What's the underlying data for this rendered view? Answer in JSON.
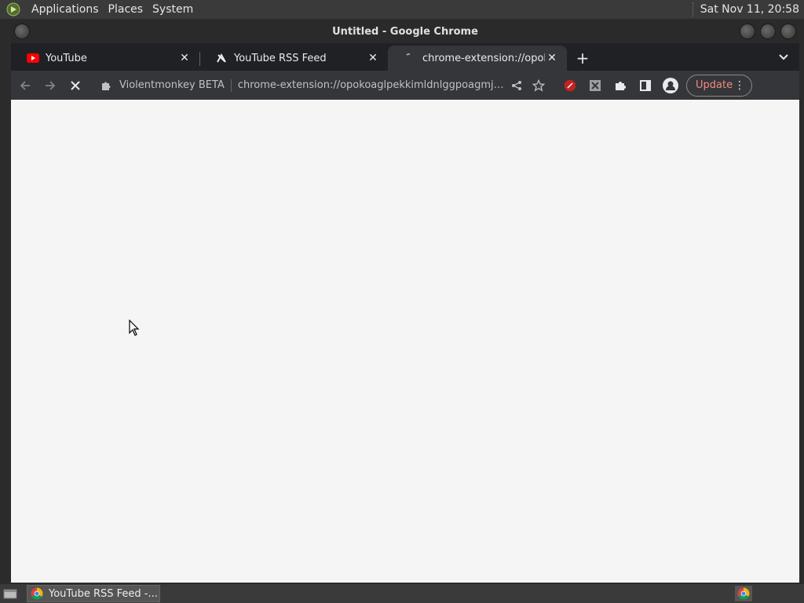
{
  "top_panel": {
    "menus": [
      "Applications",
      "Places",
      "System"
    ],
    "clock": "Sat Nov 11, 20:58"
  },
  "window": {
    "title": "Untitled - Google Chrome"
  },
  "tabs": [
    {
      "title": "YouTube",
      "icon": "youtube-icon",
      "active": false
    },
    {
      "title": "YouTube RSS Feed",
      "icon": "rss-feed-icon",
      "active": false
    },
    {
      "title": "chrome-extension://opokoagl",
      "icon": "loading-icon",
      "active": true
    }
  ],
  "toolbar": {
    "site_name": "Violentmonkey BETA",
    "url": "chrome-extension://opokoaglpekkimldnlggpoagmjegichg/c...",
    "update_label": "Update"
  },
  "taskbar": {
    "task_label": "YouTube RSS Feed -..."
  },
  "colors": {
    "update_text": "#f28b82",
    "youtube_red": "#ff0000"
  }
}
